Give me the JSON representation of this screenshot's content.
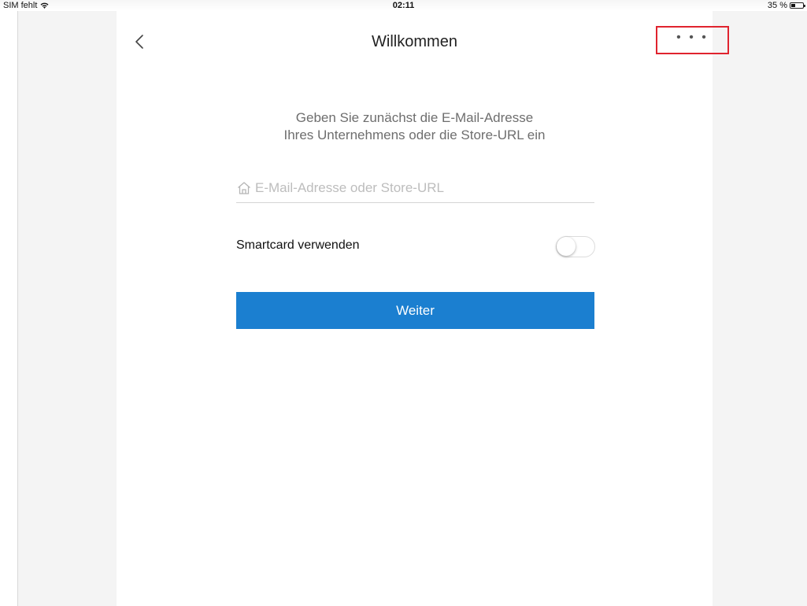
{
  "status_bar": {
    "carrier": "SIM fehlt",
    "time": "02:11",
    "battery_text": "35 %",
    "battery_level": 0.35
  },
  "nav": {
    "title": "Willkommen",
    "more_label": "• • •"
  },
  "intro": {
    "line1": "Geben Sie zunächst die E-Mail-Adresse",
    "line2": "Ihres Unternehmens oder die Store-URL ein"
  },
  "email_field": {
    "placeholder": "E-Mail-Adresse oder Store-URL",
    "value": ""
  },
  "smartcard": {
    "label": "Smartcard verwenden",
    "enabled": false
  },
  "continue_button": {
    "label": "Weiter"
  },
  "colors": {
    "primary": "#1b7fd0",
    "highlight": "#e0232e"
  },
  "icons": [
    "wifi-icon",
    "battery-icon",
    "back-chevron-icon",
    "more-icon",
    "home-icon"
  ]
}
